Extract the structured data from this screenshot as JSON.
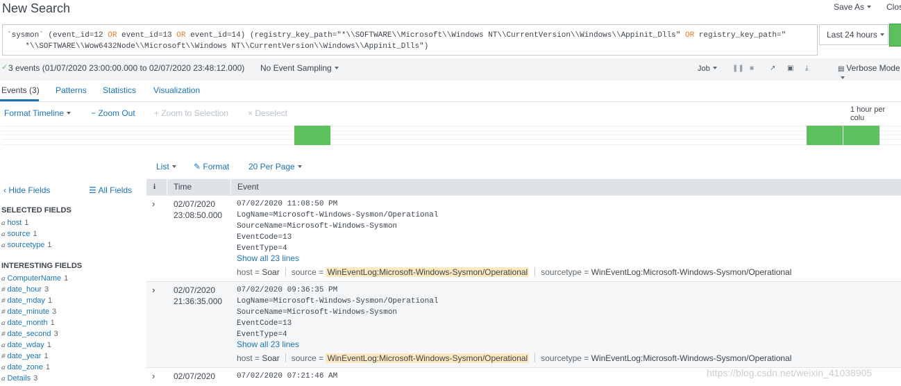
{
  "header": {
    "title": "New Search",
    "save_as": "Save As",
    "close": "Clos"
  },
  "search": {
    "part1": "`sysmon` (event_id=12 ",
    "op1": "OR",
    "part2": " event_id=13 ",
    "op2": "OR",
    "part3": " event_id=14) (registry_key_path=\"*\\\\SOFTWARE\\\\Microsoft\\\\Windows NT\\\\CurrentVersion\\\\Windows\\\\Appinit_Dlls\" ",
    "op3": "OR",
    "part4": " registry_key_path=\"\n    *\\\\SOFTWARE\\\\Wow6432Node\\\\Microsoft\\\\Windows NT\\\\CurrentVersion\\\\Windows\\\\Appinit_Dlls\")",
    "time_range": "Last 24 hours"
  },
  "status": {
    "summary": "3 events (01/07/2020 23:00:00.000 to 02/07/2020 23:48:12.000)",
    "sampling": "No Event Sampling",
    "job": "Job",
    "mode": "Verbose Mode"
  },
  "tabs": [
    {
      "label": "Events (3)"
    },
    {
      "label": "Patterns"
    },
    {
      "label": "Statistics"
    },
    {
      "label": "Visualization"
    }
  ],
  "timeline": {
    "format": "Format Timeline",
    "zoom_out": "Zoom Out",
    "zoom_selection": "Zoom to Selection",
    "deselect": "Deselect",
    "scale": "1 hour per colu",
    "buckets": [
      0,
      0,
      0,
      0,
      0,
      0,
      0,
      0,
      1,
      0,
      0,
      0,
      0,
      0,
      0,
      0,
      0,
      0,
      0,
      0,
      0,
      0,
      1,
      1
    ]
  },
  "results_controls": {
    "list": "List",
    "format": "Format",
    "per_page": "20 Per Page"
  },
  "sidebar": {
    "hide_fields": "Hide Fields",
    "all_fields": "All Fields",
    "selected_heading": "SELECTED FIELDS",
    "selected": [
      {
        "type": "a",
        "name": "host",
        "count": "1"
      },
      {
        "type": "a",
        "name": "source",
        "count": "1"
      },
      {
        "type": "a",
        "name": "sourcetype",
        "count": "1"
      }
    ],
    "interesting_heading": "INTERESTING FIELDS",
    "interesting": [
      {
        "type": "a",
        "name": "ComputerName",
        "count": "1"
      },
      {
        "type": "#",
        "name": "date_hour",
        "count": "3"
      },
      {
        "type": "#",
        "name": "date_mday",
        "count": "1"
      },
      {
        "type": "#",
        "name": "date_minute",
        "count": "3"
      },
      {
        "type": "a",
        "name": "date_month",
        "count": "1"
      },
      {
        "type": "#",
        "name": "date_second",
        "count": "3"
      },
      {
        "type": "a",
        "name": "date_wday",
        "count": "1"
      },
      {
        "type": "#",
        "name": "date_year",
        "count": "1"
      },
      {
        "type": "a",
        "name": "date_zone",
        "count": "1"
      },
      {
        "type": "a",
        "name": "Details",
        "count": "3"
      }
    ]
  },
  "table": {
    "col_info": "i",
    "col_time": "Time",
    "col_event": "Event",
    "rows": [
      {
        "date": "02/07/2020",
        "time": "23:08:50.000",
        "lines": [
          "07/02/2020 11:08:50 PM",
          "LogName=Microsoft-Windows-Sysmon/Operational",
          "SourceName=Microsoft-Windows-Sysmon",
          "EventCode=13",
          "EventType=4"
        ],
        "show_all": "Show all 23 lines",
        "host_key": "host =",
        "host": "Soar",
        "source_key": "source =",
        "source": "WinEventLog:Microsoft-Windows-Sysmon/Operational",
        "sourcetype_key": "sourcetype =",
        "sourcetype": "WinEventLog:Microsoft-Windows-Sysmon/Operational"
      },
      {
        "date": "02/07/2020",
        "time": "21:36:35.000",
        "lines": [
          "07/02/2020 09:36:35 PM",
          "LogName=Microsoft-Windows-Sysmon/Operational",
          "SourceName=Microsoft-Windows-Sysmon",
          "EventCode=13",
          "EventType=4"
        ],
        "show_all": "Show all 23 lines",
        "host_key": "host =",
        "host": "Soar",
        "source_key": "source =",
        "source": "WinEventLog:Microsoft-Windows-Sysmon/Operational",
        "sourcetype_key": "sourcetype =",
        "sourcetype": "WinEventLog:Microsoft-Windows-Sysmon/Operational"
      },
      {
        "date": "02/07/2020",
        "lines": [
          "07/02/2020 07:21:46 AM"
        ]
      }
    ]
  },
  "watermark": "https://blog.csdn.net/weixin_41038905",
  "colors": {
    "accent": "#1a73b8",
    "success": "#5cc05c",
    "highlight": "#fde9c0"
  }
}
